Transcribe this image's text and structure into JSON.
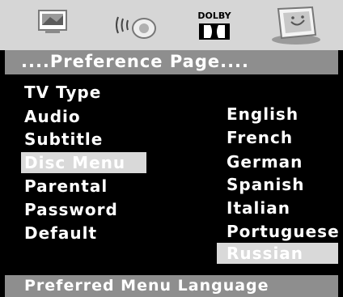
{
  "icon_bar": {
    "icons": [
      "tv-picture-icon",
      "audio-speaker-icon",
      "dolby-icon",
      "preference-monitor-icon"
    ],
    "dolby_text": "DOLBY"
  },
  "header": {
    "title": "....Preference Page...."
  },
  "menu": {
    "items": [
      {
        "label": "TV Type",
        "selected": false
      },
      {
        "label": "Audio",
        "selected": false
      },
      {
        "label": "Subtitle",
        "selected": false
      },
      {
        "label": "Disc Menu",
        "selected": true
      },
      {
        "label": "Parental",
        "selected": false
      },
      {
        "label": "Password",
        "selected": false
      },
      {
        "label": "Default",
        "selected": false
      }
    ]
  },
  "options": {
    "items": [
      {
        "label": "English",
        "selected": false
      },
      {
        "label": "French",
        "selected": false
      },
      {
        "label": "German",
        "selected": false
      },
      {
        "label": "Spanish",
        "selected": false
      },
      {
        "label": "Italian",
        "selected": false
      },
      {
        "label": "Portuguese",
        "selected": false
      },
      {
        "label": "Russian",
        "selected": true
      }
    ]
  },
  "status_bar": {
    "text": "Preferred Menu Language"
  },
  "colors": {
    "background": "#000000",
    "bar": "#8e8e8e",
    "highlight": "#d9d9d9",
    "icon_bar": "#d6d6d6"
  }
}
